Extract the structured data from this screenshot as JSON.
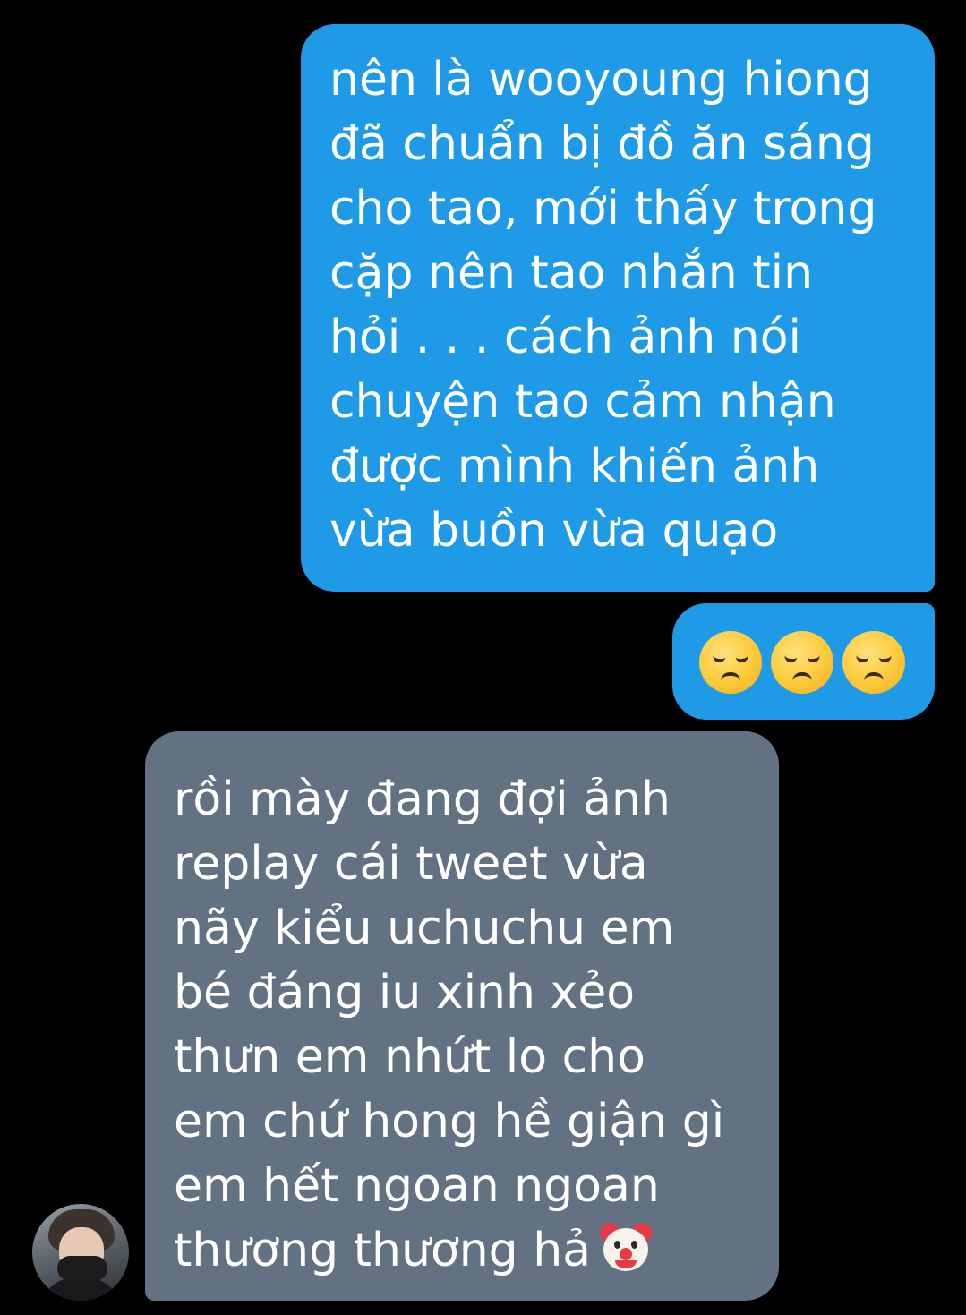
{
  "conversation": {
    "messages": [
      {
        "direction": "sent",
        "lines": [
          "nên là wooyoung hiong",
          "đã chuẩn bị đồ ăn sáng",
          "cho tao, mới thấy trong",
          "cặp nên tao nhắn tin",
          "hỏi . . . cách ảnh nói",
          "chuyện tao cảm nhận",
          "được mình khiến ảnh",
          "vừa buồn vừa quạo"
        ]
      },
      {
        "direction": "sent",
        "emojis": [
          "disappointed-face",
          "disappointed-face",
          "disappointed-face"
        ]
      },
      {
        "direction": "received",
        "lines": [
          "rồi mày đang đợi ảnh",
          "replay cái tweet vừa",
          "nãy kiểu uchuchu em",
          "bé đáng iu xinh xẻo",
          "thưn em nhứt lo cho",
          "em chứ hong hề giận gì",
          "em hết ngoan ngoan",
          "thương thương hả"
        ],
        "trailing_emoji": "clown-face"
      }
    ]
  },
  "colors": {
    "background": "#000000",
    "sent_bubble": "#1e9ae6",
    "received_bubble": "#627282",
    "text": "#ffffff"
  }
}
